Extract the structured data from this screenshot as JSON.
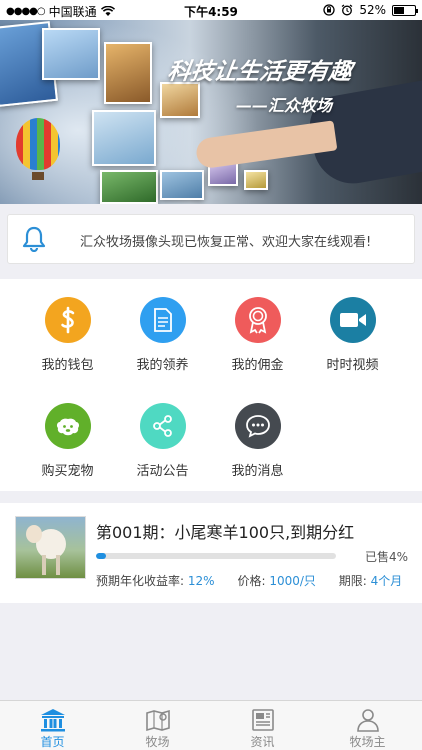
{
  "status_bar": {
    "signal": "●●●●○",
    "carrier": "中国联通",
    "time": "下午4:59",
    "battery": "52%",
    "battery_level": 0.52
  },
  "banner": {
    "title": "科技让生活更有趣",
    "subtitle": "——汇众牧场"
  },
  "notice": {
    "icon": "bell-icon",
    "text": "汇众牧场摄像头现已恢复正常、欢迎大家在线观看!"
  },
  "menu": [
    {
      "label": "我的钱包",
      "icon": "dollar-icon",
      "color": "#f3a51f"
    },
    {
      "label": "我的领养",
      "icon": "document-icon",
      "color": "#2f9ff0"
    },
    {
      "label": "我的佣金",
      "icon": "medal-icon",
      "color": "#ef5b5b"
    },
    {
      "label": "时时视频",
      "icon": "video-camera-icon",
      "color": "#1b7fa3"
    },
    {
      "label": "购买宠物",
      "icon": "sheep-icon",
      "color": "#61b02a"
    },
    {
      "label": "活动公告",
      "icon": "share-icon",
      "color": "#4fd9c2"
    },
    {
      "label": "我的消息",
      "icon": "chat-icon",
      "color": "#454a50"
    }
  ],
  "product": {
    "title": "第001期：小尾寒羊100只,到期分红",
    "sold_label": "已售4%",
    "progress": 0.04,
    "yield_label": "预期年化收益率:",
    "yield_value": "12%",
    "price_label": "价格:",
    "price_value": "1000/只",
    "term_label": "期限:",
    "term_value": "4个月"
  },
  "tabs": [
    {
      "label": "首页",
      "icon": "bank-icon",
      "active": true
    },
    {
      "label": "牧场",
      "icon": "map-icon",
      "active": false
    },
    {
      "label": "资讯",
      "icon": "newspaper-icon",
      "active": false
    },
    {
      "label": "牧场主",
      "icon": "user-icon",
      "active": false
    }
  ],
  "colors": {
    "accent": "#1f8fe0",
    "inactive": "#8a8a8a"
  }
}
